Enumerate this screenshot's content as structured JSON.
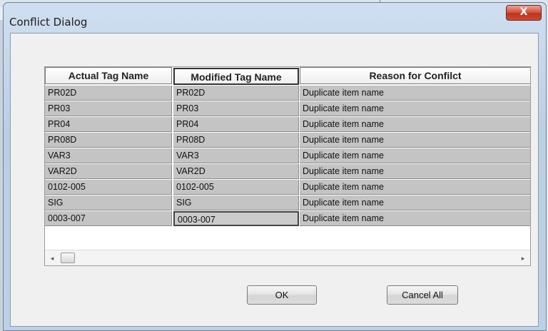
{
  "window": {
    "title": "Conflict Dialog",
    "close_label": "X"
  },
  "table": {
    "headers": [
      "Actual Tag Name",
      "Modified Tag Name",
      "Reason for Confilct"
    ],
    "rows": [
      [
        "PR02D",
        "PR02D",
        "Duplicate item name"
      ],
      [
        "PR03",
        "PR03",
        "Duplicate item name"
      ],
      [
        "PR04",
        "PR04",
        "Duplicate item name"
      ],
      [
        "PR08D",
        "PR08D",
        "Duplicate item name"
      ],
      [
        "VAR3",
        "VAR3",
        "Duplicate item name"
      ],
      [
        "VAR2D",
        "VAR2D",
        "Duplicate item name"
      ],
      [
        "0102-005",
        "0102-005",
        "Duplicate item name"
      ],
      [
        "SIG",
        "SIG",
        "Duplicate item name"
      ],
      [
        "0003-007",
        "0003-007",
        "Duplicate item name"
      ]
    ],
    "selected_row": 8,
    "selected_column": 1
  },
  "scrollbar": {
    "left_arrow": "◂",
    "right_arrow": "▸"
  },
  "buttons": {
    "ok": "OK",
    "cancel_all": "Cancel All"
  }
}
